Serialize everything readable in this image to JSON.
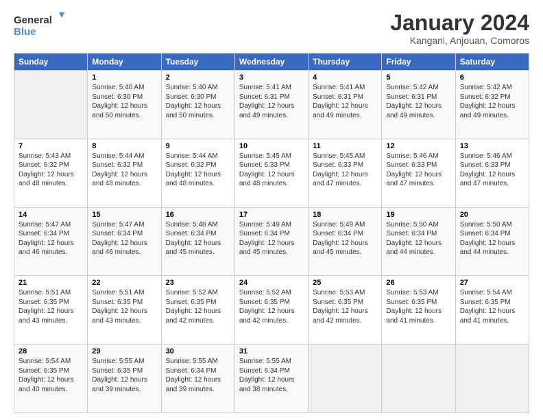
{
  "header": {
    "logo_line1": "General",
    "logo_line2": "Blue",
    "title": "January 2024",
    "subtitle": "Kangani, Anjouan, Comoros"
  },
  "calendar": {
    "days_of_week": [
      "Sunday",
      "Monday",
      "Tuesday",
      "Wednesday",
      "Thursday",
      "Friday",
      "Saturday"
    ],
    "weeks": [
      [
        {
          "num": "",
          "info": ""
        },
        {
          "num": "1",
          "info": "Sunrise: 5:40 AM\nSunset: 6:30 PM\nDaylight: 12 hours\nand 50 minutes."
        },
        {
          "num": "2",
          "info": "Sunrise: 5:40 AM\nSunset: 6:30 PM\nDaylight: 12 hours\nand 50 minutes."
        },
        {
          "num": "3",
          "info": "Sunrise: 5:41 AM\nSunset: 6:31 PM\nDaylight: 12 hours\nand 49 minutes."
        },
        {
          "num": "4",
          "info": "Sunrise: 5:41 AM\nSunset: 6:31 PM\nDaylight: 12 hours\nand 49 minutes."
        },
        {
          "num": "5",
          "info": "Sunrise: 5:42 AM\nSunset: 6:31 PM\nDaylight: 12 hours\nand 49 minutes."
        },
        {
          "num": "6",
          "info": "Sunrise: 5:42 AM\nSunset: 6:32 PM\nDaylight: 12 hours\nand 49 minutes."
        }
      ],
      [
        {
          "num": "7",
          "info": "Sunrise: 5:43 AM\nSunset: 6:32 PM\nDaylight: 12 hours\nand 48 minutes."
        },
        {
          "num": "8",
          "info": "Sunrise: 5:44 AM\nSunset: 6:32 PM\nDaylight: 12 hours\nand 48 minutes."
        },
        {
          "num": "9",
          "info": "Sunrise: 5:44 AM\nSunset: 6:32 PM\nDaylight: 12 hours\nand 48 minutes."
        },
        {
          "num": "10",
          "info": "Sunrise: 5:45 AM\nSunset: 6:33 PM\nDaylight: 12 hours\nand 48 minutes."
        },
        {
          "num": "11",
          "info": "Sunrise: 5:45 AM\nSunset: 6:33 PM\nDaylight: 12 hours\nand 47 minutes."
        },
        {
          "num": "12",
          "info": "Sunrise: 5:46 AM\nSunset: 6:33 PM\nDaylight: 12 hours\nand 47 minutes."
        },
        {
          "num": "13",
          "info": "Sunrise: 5:46 AM\nSunset: 6:33 PM\nDaylight: 12 hours\nand 47 minutes."
        }
      ],
      [
        {
          "num": "14",
          "info": "Sunrise: 5:47 AM\nSunset: 6:34 PM\nDaylight: 12 hours\nand 46 minutes."
        },
        {
          "num": "15",
          "info": "Sunrise: 5:47 AM\nSunset: 6:34 PM\nDaylight: 12 hours\nand 46 minutes."
        },
        {
          "num": "16",
          "info": "Sunrise: 5:48 AM\nSunset: 6:34 PM\nDaylight: 12 hours\nand 45 minutes."
        },
        {
          "num": "17",
          "info": "Sunrise: 5:49 AM\nSunset: 6:34 PM\nDaylight: 12 hours\nand 45 minutes."
        },
        {
          "num": "18",
          "info": "Sunrise: 5:49 AM\nSunset: 6:34 PM\nDaylight: 12 hours\nand 45 minutes."
        },
        {
          "num": "19",
          "info": "Sunrise: 5:50 AM\nSunset: 6:34 PM\nDaylight: 12 hours\nand 44 minutes."
        },
        {
          "num": "20",
          "info": "Sunrise: 5:50 AM\nSunset: 6:34 PM\nDaylight: 12 hours\nand 44 minutes."
        }
      ],
      [
        {
          "num": "21",
          "info": "Sunrise: 5:51 AM\nSunset: 6:35 PM\nDaylight: 12 hours\nand 43 minutes."
        },
        {
          "num": "22",
          "info": "Sunrise: 5:51 AM\nSunset: 6:35 PM\nDaylight: 12 hours\nand 43 minutes."
        },
        {
          "num": "23",
          "info": "Sunrise: 5:52 AM\nSunset: 6:35 PM\nDaylight: 12 hours\nand 42 minutes."
        },
        {
          "num": "24",
          "info": "Sunrise: 5:52 AM\nSunset: 6:35 PM\nDaylight: 12 hours\nand 42 minutes."
        },
        {
          "num": "25",
          "info": "Sunrise: 5:53 AM\nSunset: 6:35 PM\nDaylight: 12 hours\nand 42 minutes."
        },
        {
          "num": "26",
          "info": "Sunrise: 5:53 AM\nSunset: 6:35 PM\nDaylight: 12 hours\nand 41 minutes."
        },
        {
          "num": "27",
          "info": "Sunrise: 5:54 AM\nSunset: 6:35 PM\nDaylight: 12 hours\nand 41 minutes."
        }
      ],
      [
        {
          "num": "28",
          "info": "Sunrise: 5:54 AM\nSunset: 6:35 PM\nDaylight: 12 hours\nand 40 minutes."
        },
        {
          "num": "29",
          "info": "Sunrise: 5:55 AM\nSunset: 6:35 PM\nDaylight: 12 hours\nand 39 minutes."
        },
        {
          "num": "30",
          "info": "Sunrise: 5:55 AM\nSunset: 6:34 PM\nDaylight: 12 hours\nand 39 minutes."
        },
        {
          "num": "31",
          "info": "Sunrise: 5:55 AM\nSunset: 6:34 PM\nDaylight: 12 hours\nand 38 minutes."
        },
        {
          "num": "",
          "info": ""
        },
        {
          "num": "",
          "info": ""
        },
        {
          "num": "",
          "info": ""
        }
      ]
    ]
  }
}
